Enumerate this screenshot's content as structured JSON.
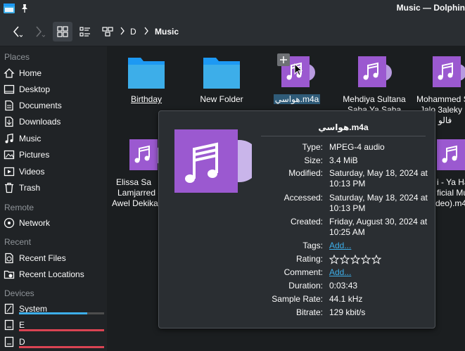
{
  "window": {
    "title": "Music — Dolphin"
  },
  "breadcrumb": {
    "items": [
      "D",
      "Music"
    ]
  },
  "sidebar": {
    "sections": {
      "places": "Places",
      "remote": "Remote",
      "recent": "Recent",
      "devices": "Devices"
    },
    "places": [
      {
        "label": "Home",
        "icon": "home-icon"
      },
      {
        "label": "Desktop",
        "icon": "desktop-icon"
      },
      {
        "label": "Documents",
        "icon": "documents-icon"
      },
      {
        "label": "Downloads",
        "icon": "downloads-icon"
      },
      {
        "label": "Music",
        "icon": "music-icon"
      },
      {
        "label": "Pictures",
        "icon": "pictures-icon"
      },
      {
        "label": "Videos",
        "icon": "videos-icon"
      },
      {
        "label": "Trash",
        "icon": "trash-icon"
      }
    ],
    "remote": [
      {
        "label": "Network",
        "icon": "network-icon"
      }
    ],
    "recent": [
      {
        "label": "Recent Files",
        "icon": "recent-files-icon"
      },
      {
        "label": "Recent Locations",
        "icon": "recent-locations-icon"
      }
    ],
    "devices": [
      {
        "label": "System",
        "usage": 0.8,
        "color": "#3daee9"
      },
      {
        "label": "E",
        "usage": 1.0,
        "color": "#da4453"
      },
      {
        "label": "D",
        "usage": 1.0,
        "color": "#da4453"
      }
    ]
  },
  "files": {
    "row1": [
      {
        "name": "Birthday",
        "type": "folder"
      },
      {
        "name": "New Folder",
        "type": "folder"
      },
      {
        "name": "هواسي.m4a",
        "type": "audio"
      },
      {
        "name_line1": "Mehdiya Sultana",
        "name_line2": "Saba Ya Saba",
        "type": "audio"
      },
      {
        "name_line1": "Mohammed S",
        "name_line2": "Jalo 3aleky",
        "name_line3": "فالو",
        "type": "audio"
      }
    ],
    "row2": [
      {
        "name_line1": "Elissa  Sa",
        "name_line2": "Lamjarred -",
        "name_line3": "Awel Dekika",
        "type": "audio"
      },
      {
        "name_line1": "i - Ya Ha",
        "name_line2": "ficial Mu",
        "name_line3": "deo).m4a",
        "type": "audio"
      }
    ]
  },
  "tooltip": {
    "filename": "هواسي.m4a",
    "rows": [
      {
        "key": "Type:",
        "value": "MPEG-4 audio"
      },
      {
        "key": "Size:",
        "value": "3.4 MiB"
      },
      {
        "key": "Modified:",
        "value": "Saturday, May 18, 2024 at",
        "value2": "10:13 PM"
      },
      {
        "key": "Accessed:",
        "value": "Saturday, May 18, 2024 at",
        "value2": "10:13 PM"
      },
      {
        "key": "Created:",
        "value": "Friday, August 30, 2024 at",
        "value2": "10:25 AM"
      },
      {
        "key": "Tags:",
        "value": "Add..."
      },
      {
        "key": "Rating:",
        "value": ""
      },
      {
        "key": "Comment:",
        "value": "Add..."
      },
      {
        "key": "Duration:",
        "value": "0:03:43"
      },
      {
        "key": "Sample Rate:",
        "value": "44.1 kHz"
      },
      {
        "key": "Bitrate:",
        "value": "129 kbit/s"
      }
    ],
    "rating_stars": 0
  }
}
